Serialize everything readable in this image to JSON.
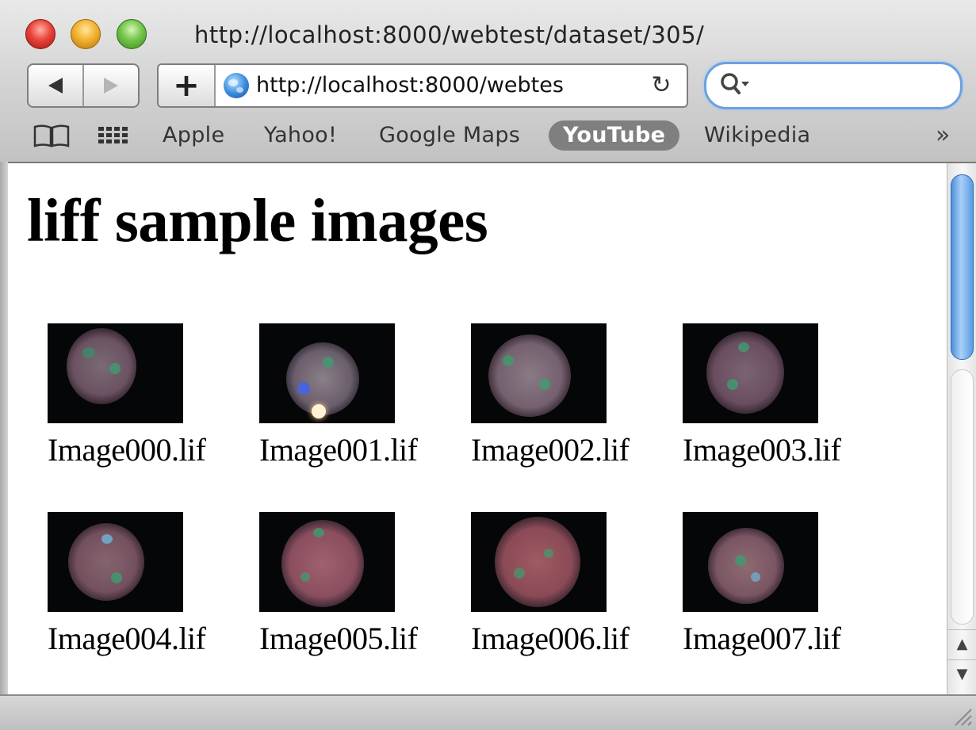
{
  "window": {
    "title": "http://localhost:8000/webtest/dataset/305/"
  },
  "toolbar": {
    "back_icon": "back-arrow-icon",
    "forward_icon": "forward-arrow-icon",
    "add_label": "+",
    "address_url": "http://localhost:8000/webtes",
    "reload_glyph": "↻",
    "search_placeholder": ""
  },
  "bookmarks": {
    "items": [
      {
        "label": "Apple",
        "active": false
      },
      {
        "label": "Yahoo!",
        "active": false
      },
      {
        "label": "Google Maps",
        "active": false
      },
      {
        "label": "YouTube",
        "active": true
      },
      {
        "label": "Wikipedia",
        "active": false
      }
    ],
    "more_glyph": "»"
  },
  "page": {
    "title": "liff sample images",
    "images": [
      {
        "caption": "Image000.lif"
      },
      {
        "caption": "Image001.lif"
      },
      {
        "caption": "Image002.lif"
      },
      {
        "caption": "Image003.lif"
      },
      {
        "caption": "Image004.lif"
      },
      {
        "caption": "Image005.lif"
      },
      {
        "caption": "Image006.lif"
      },
      {
        "caption": "Image007.lif"
      }
    ]
  },
  "scrollbar": {
    "up_glyph": "▲",
    "down_glyph": "▼"
  },
  "colors": {
    "accent_blue": "#6aa2e0",
    "active_bookmark_bg": "#7f7f7f",
    "thumb_background": "#050607"
  }
}
